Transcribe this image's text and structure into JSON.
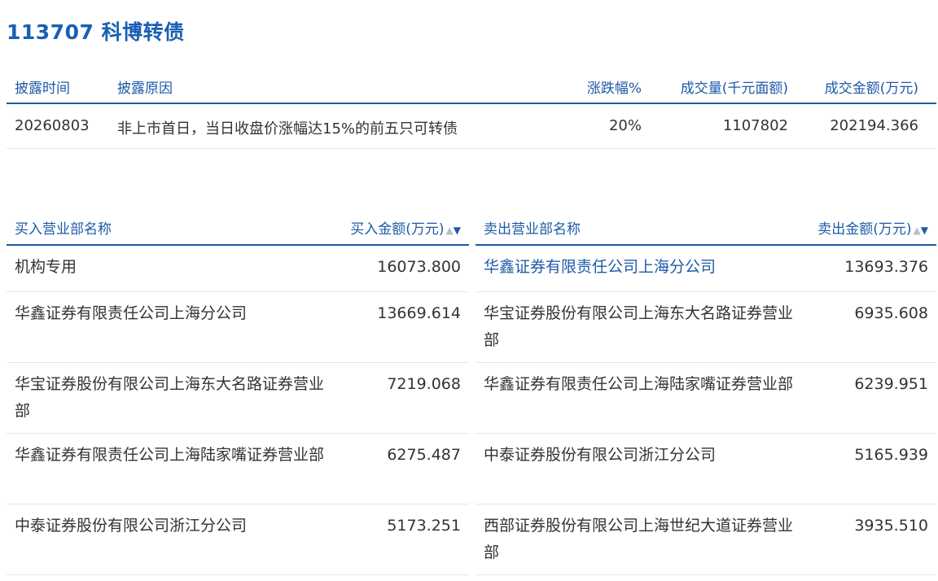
{
  "title": "113707 科博转债",
  "top_table": {
    "headers": [
      "披露时间",
      "披露原因",
      "涨跌幅%",
      "成交量(千元面额)",
      "成交金额(万元)"
    ],
    "row": [
      "20260803",
      "非上市首日，当日收盘价涨幅达15%的前五只可转债",
      "20%",
      "1107802",
      "202194.366"
    ]
  },
  "buy": {
    "header_name": "买入营业部名称",
    "header_amount": "买入金额(万元)",
    "rows": [
      {
        "name": "机构专用",
        "amount": "16073.800"
      },
      {
        "name": "华鑫证券有限责任公司上海分公司",
        "amount": "13669.614"
      },
      {
        "name": "华宝证券股份有限公司上海东大名路证券营业部",
        "amount": "7219.068"
      },
      {
        "name": "华鑫证券有限责任公司上海陆家嘴证券营业部",
        "amount": "6275.487"
      },
      {
        "name": "中泰证券股份有限公司浙江分公司",
        "amount": "5173.251"
      }
    ]
  },
  "sell": {
    "header_name": "卖出营业部名称",
    "header_amount": "卖出金额(万元)",
    "rows": [
      {
        "name": "华鑫证券有限责任公司上海分公司",
        "amount": "13693.376"
      },
      {
        "name": "华宝证券股份有限公司上海东大名路证券营业部",
        "amount": "6935.608"
      },
      {
        "name": "华鑫证券有限责任公司上海陆家嘴证券营业部",
        "amount": "6239.951"
      },
      {
        "name": "中泰证券股份有限公司浙江分公司",
        "amount": "5165.939"
      },
      {
        "name": "西部证券股份有限公司上海世纪大道证券营业部",
        "amount": "3935.510"
      }
    ]
  },
  "sort_icons": {
    "up": "▲",
    "down": "▼"
  },
  "colors": {
    "accent": "#1e5aa8",
    "title": "#1a5fb4",
    "divider": "#e3e6ea"
  }
}
